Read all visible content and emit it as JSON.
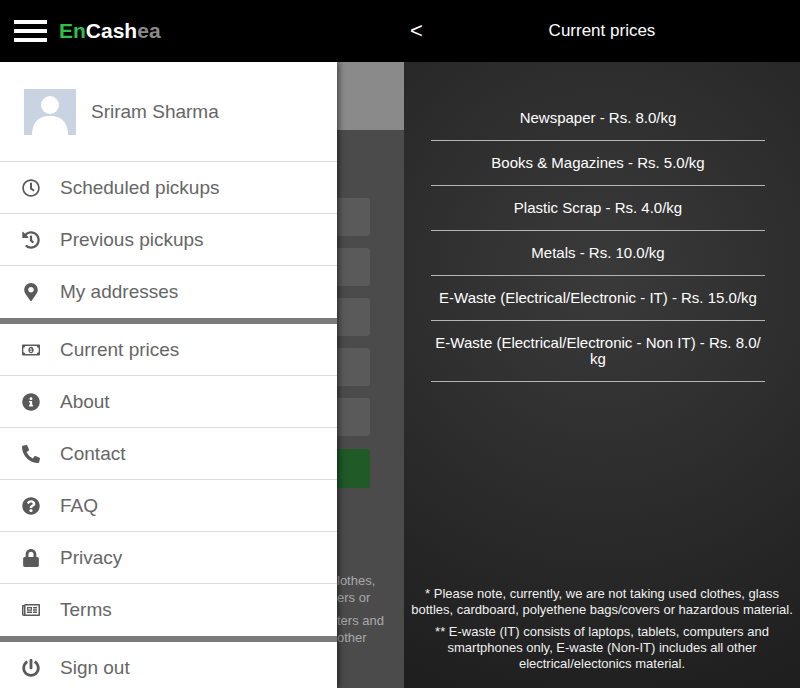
{
  "left_screen": {
    "app_bar": {
      "logo": [
        {
          "text": "En",
          "color": "#2fbf4d"
        },
        {
          "text": "Cash",
          "color": "#ffffff"
        },
        {
          "text": "ea",
          "color": "#8a8a8a"
        }
      ]
    },
    "drawer": {
      "user": {
        "name": "Sriram Sharma"
      },
      "groups": [
        [
          {
            "label": "Scheduled pickups"
          },
          {
            "label": "Previous pickups"
          },
          {
            "label": "My addresses"
          }
        ],
        [
          {
            "label": "Current prices"
          },
          {
            "label": "About"
          },
          {
            "label": "Contact"
          },
          {
            "label": "FAQ"
          },
          {
            "label": "Privacy"
          },
          {
            "label": "Terms"
          }
        ],
        [
          {
            "label": "Sign out"
          }
        ]
      ]
    },
    "backdrop": {
      "paragraphs": [
        [
          "lothes,",
          "ers or"
        ],
        [
          "ters and",
          "other"
        ]
      ]
    }
  },
  "right_screen": {
    "app_bar": {
      "back": "<",
      "title": "Current prices"
    },
    "prices": [
      "Newspaper - Rs. 8.0/kg",
      "Books & Magazines - Rs. 5.0/kg",
      "Plastic Scrap - Rs. 4.0/kg",
      "Metals - Rs. 10.0/kg",
      "E-Waste (Electrical/Electronic - IT) - Rs. 15.0/kg",
      "E-Waste (Electrical/Electronic - Non IT) - Rs. 8.0/ kg"
    ],
    "notes": [
      "* Please note, currently, we are not taking used clothes, glass bottles, cardboard, polyethene bags/covers or hazardous material.",
      "** E-waste (IT) consists of laptops, tablets, computers and smartphones only, E-waste (Non-IT) includes all other electrical/electonics material."
    ]
  }
}
